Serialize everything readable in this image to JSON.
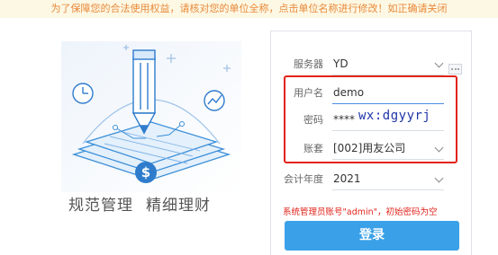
{
  "notice": "为了保障您的合法使用权益，请核对您的单位全称，点击单位名称进行修改！如正确请关闭",
  "slogan": {
    "left": "规范管理",
    "right": "精细理财"
  },
  "form": {
    "server": {
      "label": "服务器",
      "value": "YD"
    },
    "username": {
      "label": "用户名",
      "value": "demo"
    },
    "password": {
      "label": "密码",
      "value": "****"
    },
    "account": {
      "label": "账套",
      "value": "[002]用友公司"
    },
    "year": {
      "label": "会计年度",
      "value": "2021"
    },
    "hint": "系统管理员账号\"admin\"，初始密码为空",
    "login_label": "登录"
  },
  "watermark": "wx:dgyyrj",
  "colors": {
    "accent": "#3aa1e8",
    "highlight": "#e2231a",
    "notice_text": "#e8893a",
    "notice_bg": "#fdf8e4"
  },
  "icons": [
    "pencil-icon",
    "clock-icon",
    "line-chart-icon",
    "dollar-coin-icon",
    "chevron-down-icon",
    "more-icon"
  ]
}
